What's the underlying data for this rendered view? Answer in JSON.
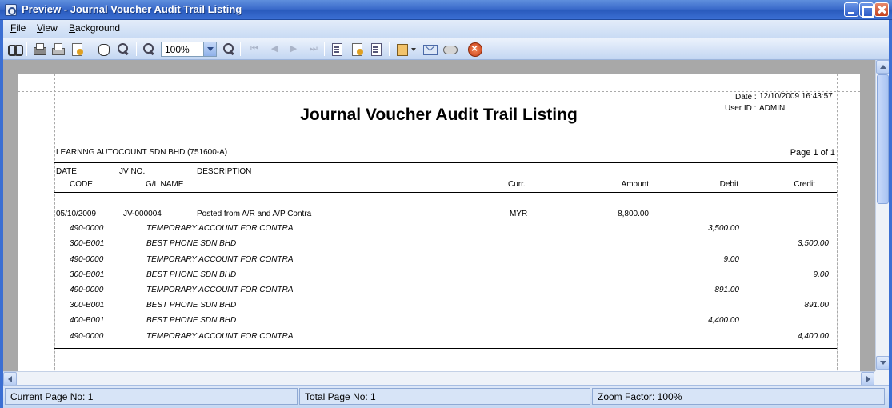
{
  "window": {
    "title": "Preview - Journal Voucher Audit Trail Listing"
  },
  "menu": [
    {
      "underline": "F",
      "rest": "ile"
    },
    {
      "underline": "V",
      "rest": "iew"
    },
    {
      "underline": "B",
      "rest": "ackground"
    }
  ],
  "toolbar": {
    "zoom_value": "100%"
  },
  "report": {
    "date_label": "Date :",
    "date_value": "12/10/2009 16:43:57",
    "user_label": "User ID :",
    "user_value": "ADMIN",
    "title": "Journal Voucher Audit Trail Listing",
    "company": "LEARNNG AUTOCOUNT SDN BHD (751600-A)",
    "page_info": "Page 1 of 1",
    "headers": {
      "date": "DATE",
      "jv_no": "JV NO.",
      "description": "DESCRIPTION",
      "code": "CODE",
      "gl_name": "G/L NAME",
      "curr": "Curr.",
      "amount": "Amount",
      "debit": "Debit",
      "credit": "Credit"
    },
    "voucher": {
      "date": "05/10/2009",
      "jv_no": "JV-000004",
      "description": "Posted from A/R and A/P Contra",
      "curr": "MYR",
      "amount": "8,800.00"
    },
    "lines": [
      {
        "code": "490-0000",
        "name": "TEMPORARY ACCOUNT FOR CONTRA",
        "debit": "3,500.00",
        "credit": ""
      },
      {
        "code": "300-B001",
        "name": "BEST PHONE SDN BHD",
        "debit": "",
        "credit": "3,500.00"
      },
      {
        "code": "490-0000",
        "name": "TEMPORARY ACCOUNT FOR CONTRA",
        "debit": "9.00",
        "credit": ""
      },
      {
        "code": "300-B001",
        "name": "BEST PHONE SDN BHD",
        "debit": "",
        "credit": "9.00"
      },
      {
        "code": "490-0000",
        "name": "TEMPORARY ACCOUNT FOR CONTRA",
        "debit": "891.00",
        "credit": ""
      },
      {
        "code": "300-B001",
        "name": "BEST PHONE SDN BHD",
        "debit": "",
        "credit": "891.00"
      },
      {
        "code": "400-B001",
        "name": "BEST PHONE SDN BHD",
        "debit": "4,400.00",
        "credit": ""
      },
      {
        "code": "490-0000",
        "name": "TEMPORARY ACCOUNT FOR CONTRA",
        "debit": "",
        "credit": "4,400.00"
      }
    ]
  },
  "status": {
    "current_page": "Current Page No: 1",
    "total_page": "Total Page No: 1",
    "zoom_factor": "Zoom Factor: 100%"
  }
}
